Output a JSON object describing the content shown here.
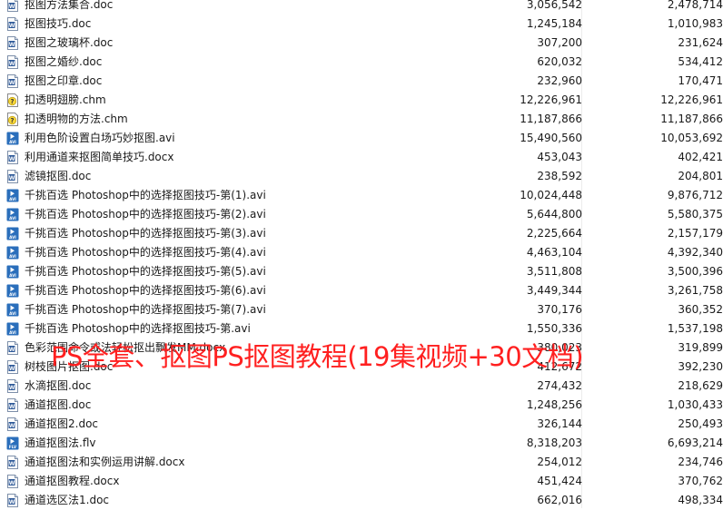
{
  "icons": {
    "doc": "word-doc-icon",
    "docx": "word-doc-icon",
    "chm": "help-chm-icon",
    "avi": "video-avi-icon",
    "flv": "video-flv-icon"
  },
  "colors": {
    "doc": "#2b5797",
    "avi": "#2a6ebb",
    "flv": "#2a6ebb",
    "chm_bg": "#f5d53a",
    "watermark": "#ff2020"
  },
  "files": [
    {
      "name": "抠图方法集合.doc",
      "type": "doc",
      "size": "3,056,542",
      "packed": "2,478,714"
    },
    {
      "name": "抠图技巧.doc",
      "type": "doc",
      "size": "1,245,184",
      "packed": "1,010,983"
    },
    {
      "name": "抠图之玻璃杯.doc",
      "type": "doc",
      "size": "307,200",
      "packed": "231,624"
    },
    {
      "name": "抠图之婚纱.doc",
      "type": "doc",
      "size": "620,032",
      "packed": "534,412"
    },
    {
      "name": "抠图之印章.doc",
      "type": "doc",
      "size": "232,960",
      "packed": "170,471"
    },
    {
      "name": "扣透明翅膀.chm",
      "type": "chm",
      "size": "12,226,961",
      "packed": "12,226,961"
    },
    {
      "name": "扣透明物的方法.chm",
      "type": "chm",
      "size": "11,187,866",
      "packed": "11,187,866"
    },
    {
      "name": "利用色阶设置白场巧妙抠图.avi",
      "type": "avi",
      "size": "15,490,560",
      "packed": "10,053,692"
    },
    {
      "name": "利用通道来抠图简单技巧.docx",
      "type": "docx",
      "size": "453,043",
      "packed": "402,421"
    },
    {
      "name": "滤镜抠图.doc",
      "type": "doc",
      "size": "238,592",
      "packed": "204,801"
    },
    {
      "name": "千挑百选 Photoshop中的选择抠图技巧-第(1).avi",
      "type": "avi",
      "size": "10,024,448",
      "packed": "9,876,712"
    },
    {
      "name": "千挑百选 Photoshop中的选择抠图技巧-第(2).avi",
      "type": "avi",
      "size": "5,644,800",
      "packed": "5,580,375"
    },
    {
      "name": "千挑百选 Photoshop中的选择抠图技巧-第(3).avi",
      "type": "avi",
      "size": "2,225,664",
      "packed": "2,157,179"
    },
    {
      "name": "千挑百选 Photoshop中的选择抠图技巧-第(4).avi",
      "type": "avi",
      "size": "4,463,104",
      "packed": "4,392,340"
    },
    {
      "name": "千挑百选 Photoshop中的选择抠图技巧-第(5).avi",
      "type": "avi",
      "size": "3,511,808",
      "packed": "3,500,396"
    },
    {
      "name": "千挑百选 Photoshop中的选择抠图技巧-第(6).avi",
      "type": "avi",
      "size": "3,449,344",
      "packed": "3,261,758"
    },
    {
      "name": "千挑百选 Photoshop中的选择抠图技巧-第(7).avi",
      "type": "avi",
      "size": "370,176",
      "packed": "360,352"
    },
    {
      "name": "千挑百选 Photoshop中的选择抠图技巧-第.avi",
      "type": "avi",
      "size": "1,550,336",
      "packed": "1,537,198"
    },
    {
      "name": "色彩范围命令或法轻松抠出飘发MM.docx",
      "type": "docx",
      "size": "380,023",
      "packed": "319,899"
    },
    {
      "name": "树枝图片抠图.doc",
      "type": "doc",
      "size": "412,672",
      "packed": "392,230"
    },
    {
      "name": "水滴抠图.doc",
      "type": "doc",
      "size": "274,432",
      "packed": "218,629"
    },
    {
      "name": "通道抠图.doc",
      "type": "doc",
      "size": "1,248,256",
      "packed": "1,030,433"
    },
    {
      "name": "通道抠图2.doc",
      "type": "doc",
      "size": "326,144",
      "packed": "250,493"
    },
    {
      "name": "通道抠图法.flv",
      "type": "flv",
      "size": "8,318,203",
      "packed": "6,693,214"
    },
    {
      "name": "通道抠图法和实例运用讲解.docx",
      "type": "docx",
      "size": "254,012",
      "packed": "234,746"
    },
    {
      "name": "通道抠图教程.docx",
      "type": "docx",
      "size": "451,424",
      "packed": "370,762"
    },
    {
      "name": "通道选区法1.doc",
      "type": "doc",
      "size": "662,016",
      "packed": "498,334"
    }
  ],
  "watermark": {
    "text": "PS全套、抠图PS抠图教程(19集视频+30文档)"
  }
}
